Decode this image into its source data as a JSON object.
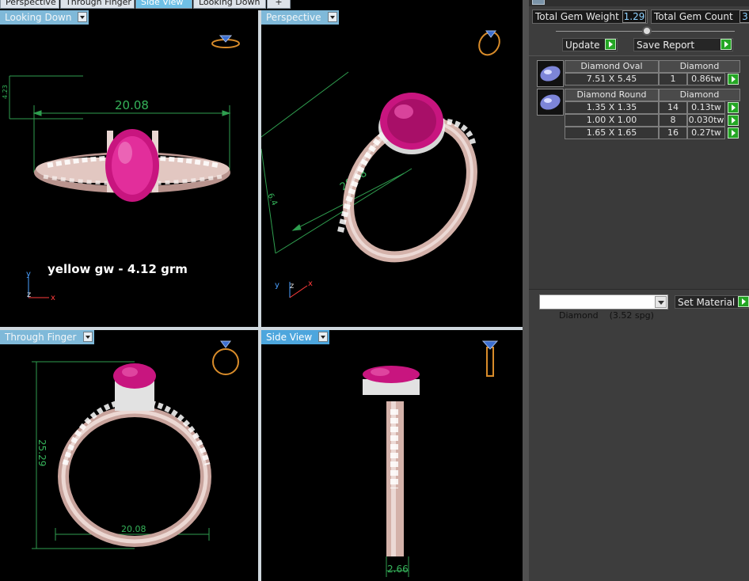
{
  "top_tabs": [
    "Perspective",
    "Through Finger",
    "Side View",
    "Looking Down",
    "+"
  ],
  "active_top_tab": "Side View",
  "viewports": {
    "looking_down": {
      "label": "Looking Down",
      "dim_width": "20.08",
      "dim_side": "4.23",
      "caption": "yellow gw - 4.12 grm",
      "axis_y": "y",
      "axis_z": "z",
      "axis_x": "x"
    },
    "perspective": {
      "label": "Perspective",
      "dim_width": "20.08",
      "dim_side": "6.4",
      "axis_y": "y",
      "axis_z": "z",
      "axis_x": "x"
    },
    "through_finger": {
      "label": "Through Finger",
      "dim_height": "25.29",
      "dim_bottom": "20.08"
    },
    "side_view": {
      "label": "Side View",
      "dim_bottom": "2.66"
    }
  },
  "panel": {
    "total_gem_weight_label": "Total Gem Weight",
    "total_gem_weight_value": "1.29",
    "total_gem_count_label": "Total Gem Count",
    "total_gem_count_value": "3",
    "update_label": "Update",
    "save_report_label": "Save Report",
    "gems": [
      {
        "shape": "Diamond Oval",
        "material": "Diamond",
        "rows": [
          {
            "size": "7.51 X 5.45",
            "count": "1",
            "weight": "0.86tw"
          }
        ]
      },
      {
        "shape": "Diamond Round",
        "material": "Diamond",
        "rows": [
          {
            "size": "1.35 X 1.35",
            "count": "14",
            "weight": "0.13tw"
          },
          {
            "size": "1.00 X 1.00",
            "count": "8",
            "weight": "0.030tw"
          },
          {
            "size": "1.65 X 1.65",
            "count": "16",
            "weight": "0.27tw"
          }
        ]
      }
    ],
    "material_select": "Diamond    (3.52 spg)",
    "set_material_label": "Set Material"
  },
  "colors": {
    "viewport_bg": "#000000",
    "panel_bg": "#3d3d3d",
    "dimension_green": "#35b35a",
    "gem_magenta": "#c8157f",
    "metal_rose": "#d8b8b0",
    "active_tab_blue": "#4da6dd"
  },
  "icons": [
    "ring-thumbnail-icon",
    "gem-icon",
    "play-arrow-icon",
    "dropdown-arrow-icon"
  ]
}
